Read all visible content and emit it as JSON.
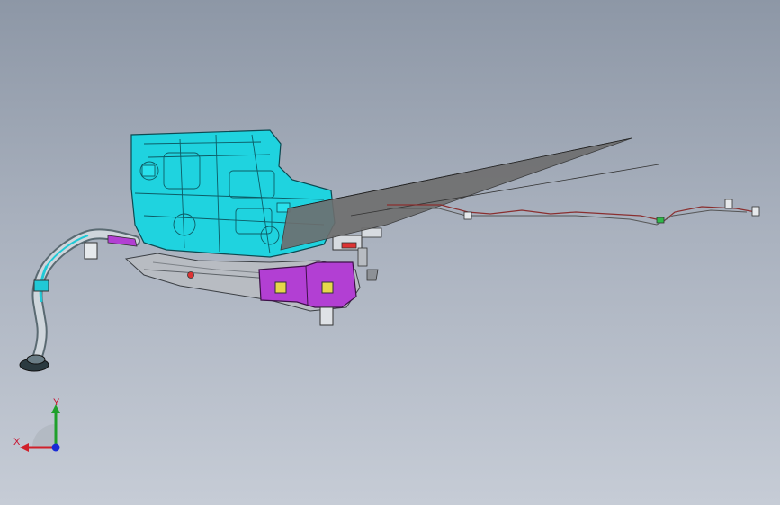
{
  "viewport": {
    "background_top": "#8d97a6",
    "background_bottom": "#c6ccd6"
  },
  "model": {
    "parts": [
      {
        "name": "fuel-tank",
        "color": "#1fd3df"
      },
      {
        "name": "heat-shield",
        "color": "#b8bcc2"
      },
      {
        "name": "canister-bracket",
        "color": "#b23fd3"
      },
      {
        "name": "filler-pipe",
        "color": "#c9d0d6"
      },
      {
        "name": "fuel-lines",
        "color": "#8a2f2f"
      },
      {
        "name": "section-plane",
        "color": "#6e6e6e"
      }
    ]
  },
  "triad": {
    "x_label": "X",
    "y_label": "Y",
    "x_color": "#d0202a",
    "y_color": "#1fa02b",
    "z_color": "#1a2bd6"
  }
}
